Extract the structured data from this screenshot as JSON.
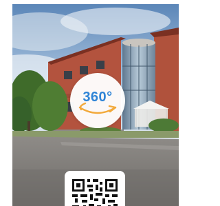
{
  "viewer": {
    "badge_label": "360°",
    "badge_icon": "rotate-360-icon",
    "accent_color": "#2f84d6",
    "orbit_arrow_color": "#f2a93b",
    "qr_icon": "qr-code-icon"
  }
}
